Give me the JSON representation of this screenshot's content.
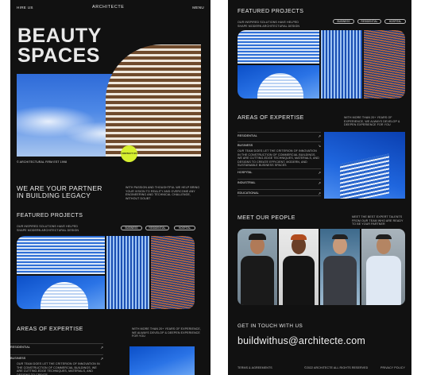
{
  "left": {
    "nav": {
      "hire": "HIRE US",
      "brand": "ARCHITECTE",
      "menu": "MENU"
    },
    "hero": {
      "title_line1": "BEAUTY",
      "title_line2": "SPACES",
      "badge": "CONTACT US",
      "est": "© ARCHITECTURAL FIRM EST 1998"
    },
    "partner": {
      "title_line1": "WE ARE YOUR PARTNER",
      "title_line2": "IN BUILDING LEGACY",
      "text": "WITH PASSION AND THOUGHTFUL WE HELP BRING YOUR VISION TO REALITY AND OVERCOME ANY ENGINEERING AND TECHNICAL CHALLENGE, WITHOUT DOUBT"
    },
    "featured": {
      "title": "FEATURED PROJECTS",
      "desc": "OUR INSPIRED SOLUTIONS HAVE HELPED SHAPE MODERN ARCHITECTURAL DESIGN",
      "tags": [
        "BUSINESS",
        "RESIDENTIAL",
        "HOSPITAL"
      ]
    },
    "expertise": {
      "title": "AREAS OF EXPERTISE",
      "desc": "WITH MORE THAN 20+ YEARS OF EXPERIENCE, WE ALWAYS DEVELOP & DEEPEN EXPERIENCE FOR YOU",
      "items": [
        "RESIDENTIAL",
        "BUSINESS"
      ],
      "business_text": "OUR TEAM DOES LET THE CRITERION OF INNOVATION IN THE CONSTRUCTION OF COMMERCIAL BUILDINGS. WE ARE CUTTING-EDGE TECHNIQUES, MATERIALS, AND DESIGNS TO CREATE"
    }
  },
  "right": {
    "featured": {
      "title": "FEATURED PROJECTS",
      "desc": "OUR INSPIRED SOLUTIONS HAVE HELPED SHAPE MODERN ARCHITECTURAL DESIGN",
      "tags": [
        "BUSINESS",
        "RESIDENTIAL",
        "HOSPITAL"
      ]
    },
    "expertise": {
      "title": "AREAS OF EXPERTISE",
      "desc": "WITH MORE THAN 20+ YEARS OF EXPERIENCE, WE ALWAYS DEVELOP & DEEPEN EXPERIENCE FOR YOU",
      "items": [
        "RESIDENTIAL",
        "BUSINESS",
        "HOSPITAL",
        "INDUSTRIAL",
        "EDUCATIONAL"
      ],
      "business_text": "OUR TEAM DOES LET THE CRITERION OF INNOVATION IN THE CONSTRUCTION OF COMMERCIAL BUILDINGS. WE ARE CUTTING-EDGE TECHNIQUES, MATERIALS, AND DESIGNS TO CREATE EFFICIENT, MODERN, AND SUSTAINABLE BUSINESS SPACES"
    },
    "people": {
      "title": "MEET OUR PEOPLE",
      "desc": "MEET THE BEST EXPERT TALENTS FROM OUR TEAM WHO ARE READY TO BE YOUR PARTNER"
    },
    "contact": {
      "title": "GET IN TOUCH WITH US",
      "email": "buildwithus@architecte.com"
    },
    "footer": {
      "terms": "TERMS & AGREEMENTS",
      "copyright": "©2022 ARCHITECTE ALL RIGHTS RESERVED",
      "privacy": "PRIVACY POLICY"
    }
  },
  "colors": {
    "background": "#111111",
    "accent": "#d7f030",
    "text": "#f2f2f2"
  },
  "icons": {
    "row_arrow": "arrow-up-right-icon"
  }
}
